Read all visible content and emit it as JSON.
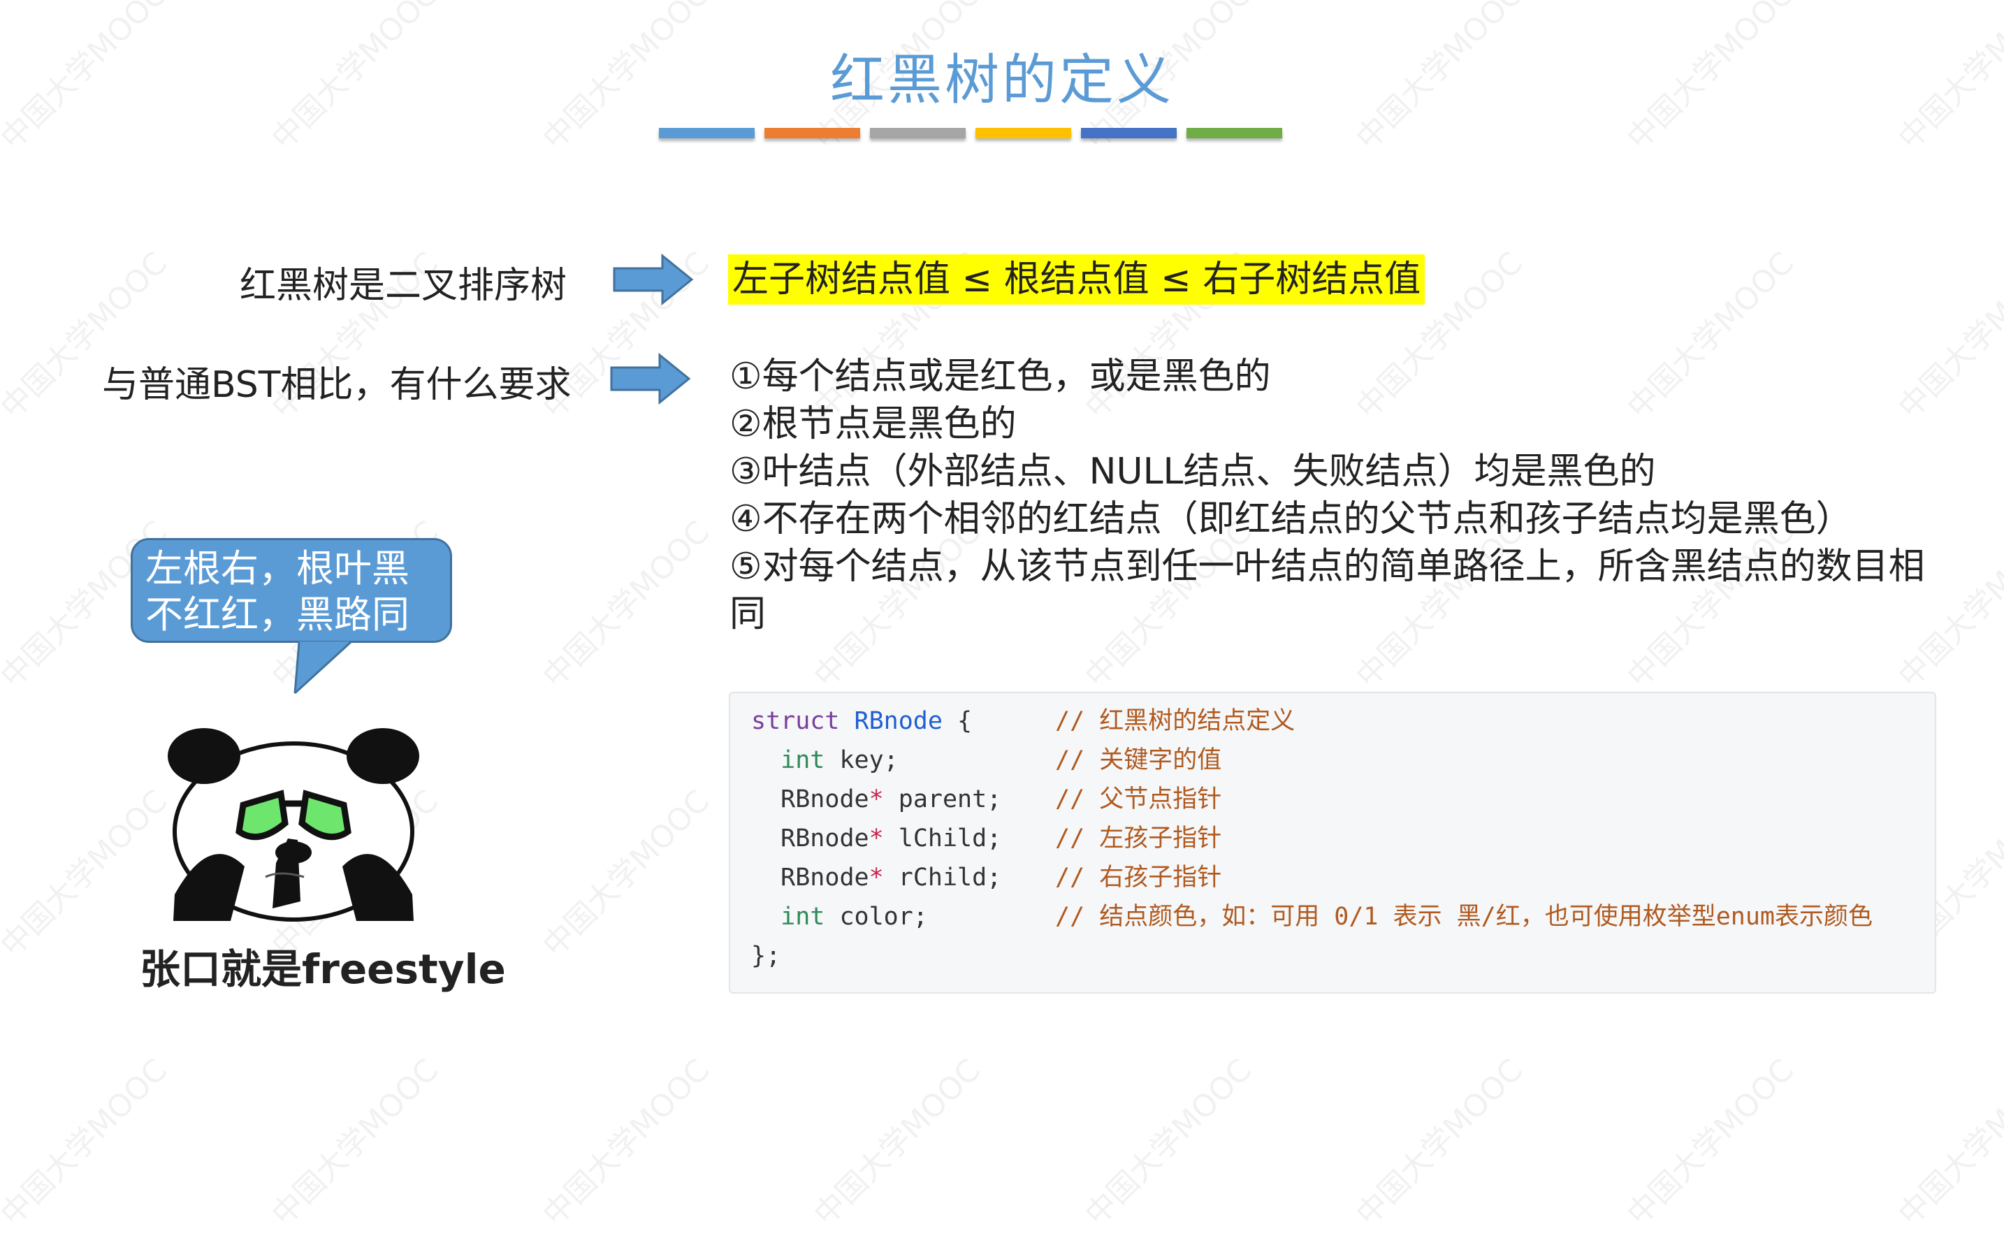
{
  "title": "红黑树的定义",
  "accent_bars": [
    "#5b9bd5",
    "#ed7d31",
    "#a5a5a5",
    "#ffc000",
    "#4472c4",
    "#70ad47"
  ],
  "watermark": "中国大学MOOC",
  "row1": {
    "label": "红黑树是二叉排序树",
    "highlight": "左子树结点值 ≤ 根结点值 ≤ 右子树结点值"
  },
  "row2": {
    "label": "与普通BST相比，有什么要求"
  },
  "rules": [
    "①每个结点或是红色，或是黑色的",
    "②根节点是黑色的",
    "③叶结点（外部结点、NULL结点、失败结点）均是黑色的",
    "④不存在两个相邻的红结点（即红结点的父节点和孩子结点均是黑色）",
    "⑤对每个结点，从该节点到任一叶结点的简单路径上，所含黑结点的数目相同"
  ],
  "bubble": {
    "line1": "左根右，根叶黑",
    "line2": "不红红，黑路同"
  },
  "meme": {
    "caption": "张口就是freestyle"
  },
  "code": {
    "struct_kw": "struct",
    "struct_name": "RBnode",
    "open": " {",
    "close": "};",
    "lines": [
      {
        "type": "int",
        "name": " key;",
        "comment": "// 红黑树的结点定义"
      },
      {
        "type": "int",
        "name": " key;",
        "comment": "// 关键字的值"
      },
      {
        "type": "RBnode",
        "star": "*",
        "name": " parent;",
        "comment": "// 父节点指针"
      },
      {
        "type": "RBnode",
        "star": "*",
        "name": " lChild;",
        "comment": "// 左孩子指针"
      },
      {
        "type": "RBnode",
        "star": "*",
        "name": " rChild;",
        "comment": "// 右孩子指针"
      },
      {
        "type": "int",
        "name": " color;",
        "comment": "// 结点颜色，如：可用 0/1 表示 黑/红，也可使用枚举型enum表示颜色"
      }
    ]
  }
}
